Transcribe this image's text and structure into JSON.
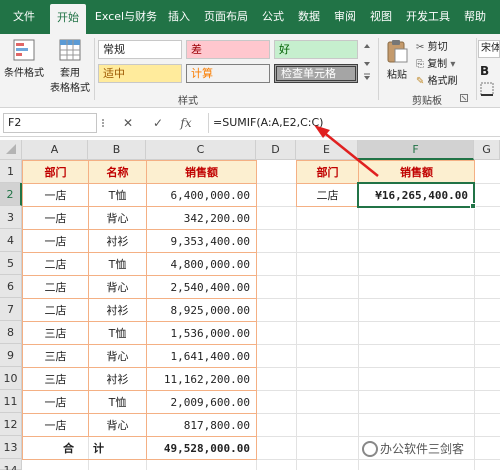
{
  "ribbon": {
    "tabs": [
      {
        "label": "文件"
      },
      {
        "label": "开始"
      },
      {
        "label": "Excel与财务"
      },
      {
        "label": "插入"
      },
      {
        "label": "页面布局"
      },
      {
        "label": "公式"
      },
      {
        "label": "数据"
      },
      {
        "label": "审阅"
      },
      {
        "label": "视图"
      },
      {
        "label": "开发工具"
      },
      {
        "label": "帮助"
      }
    ],
    "active_tab": "开始",
    "conditional_format": "条件格式",
    "table_format_line1": "套用",
    "table_format_line2": "表格格式",
    "styles": {
      "normal": "常规",
      "bad": "差",
      "good": "好",
      "neutral": "适中",
      "calculation": "计算",
      "check_cell": "检查单元格"
    },
    "styles_group_label": "样式",
    "paste": "粘贴",
    "cut": "剪切",
    "copy": "复制",
    "format_painter": "格式刷",
    "clipboard_group_label": "剪贴板",
    "font_name": "宋体",
    "colors": {
      "accent": "#217346",
      "bad_bg": "#ffc7ce",
      "good_bg": "#c6efce",
      "neutral_bg": "#ffeb9c"
    }
  },
  "formula_bar": {
    "name_box": "F2",
    "cancel_icon": "✕",
    "enter_icon": "✓",
    "fx_label": "fx",
    "formula": "=SUMIF(A:A,E2,C:C)"
  },
  "grid": {
    "columns": [
      "A",
      "B",
      "C",
      "D",
      "E",
      "F",
      "G"
    ],
    "selected_column": "F",
    "rows": [
      "1",
      "2",
      "3",
      "4",
      "5",
      "6",
      "7",
      "8",
      "9",
      "10",
      "11",
      "12",
      "13",
      "14"
    ],
    "selected_row": "2",
    "headers": {
      "dept": "部门",
      "name": "名称",
      "sales": "销售额"
    },
    "data": [
      {
        "dept": "一店",
        "name": "T恤",
        "sales": "6,400,000.00"
      },
      {
        "dept": "一店",
        "name": "背心",
        "sales": "342,200.00"
      },
      {
        "dept": "一店",
        "name": "衬衫",
        "sales": "9,353,400.00"
      },
      {
        "dept": "二店",
        "name": "T恤",
        "sales": "4,800,000.00"
      },
      {
        "dept": "二店",
        "name": "背心",
        "sales": "2,540,400.00"
      },
      {
        "dept": "二店",
        "name": "衬衫",
        "sales": "8,925,000.00"
      },
      {
        "dept": "三店",
        "name": "T恤",
        "sales": "1,536,000.00"
      },
      {
        "dept": "三店",
        "name": "背心",
        "sales": "1,641,400.00"
      },
      {
        "dept": "三店",
        "name": "衬衫",
        "sales": "11,162,200.00"
      },
      {
        "dept": "一店",
        "name": "T恤",
        "sales": "2,009,600.00"
      },
      {
        "dept": "一店",
        "name": "背心",
        "sales": "817,800.00"
      }
    ],
    "total_label_1": "合",
    "total_label_2": "计",
    "total_value": "49,528,000.00",
    "lookup": {
      "dept_header": "部门",
      "sales_header": "销售额",
      "dept_value": "二店",
      "sales_value": "¥16,265,400.00"
    }
  },
  "watermark": "办公软件三剑客"
}
